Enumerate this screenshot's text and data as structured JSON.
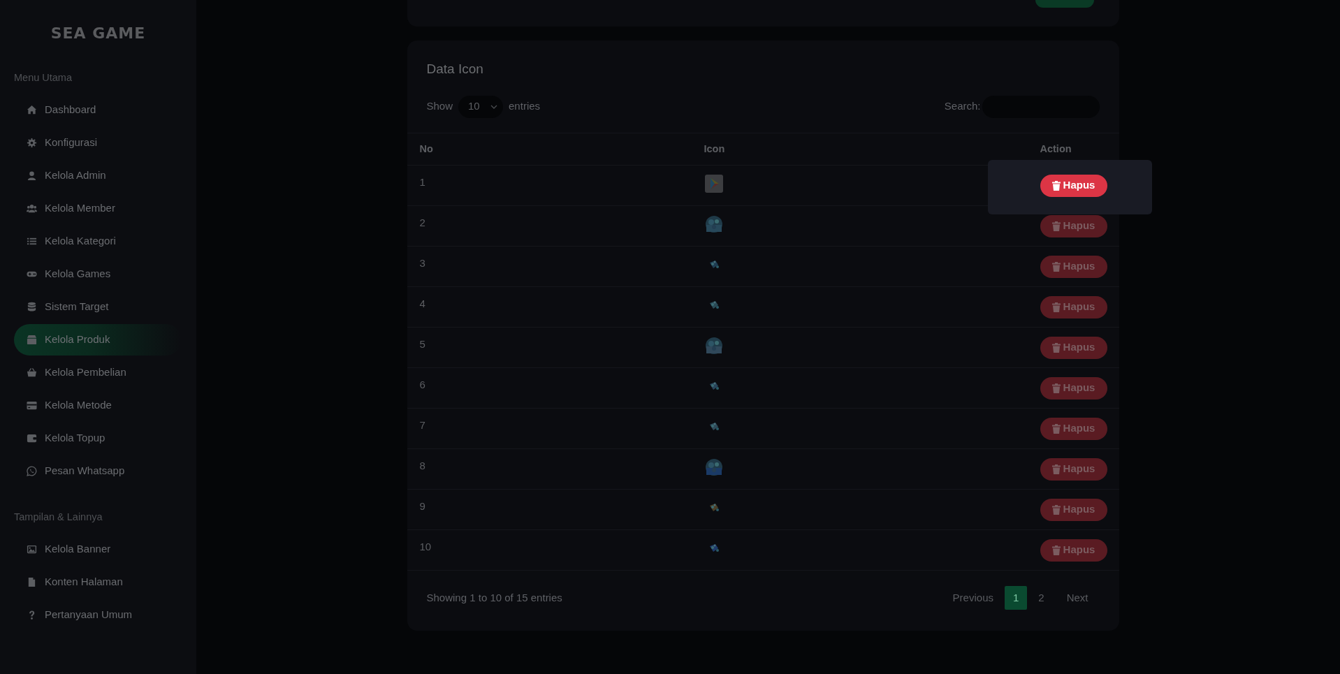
{
  "brand": "SEA GAME",
  "sidebar": {
    "sections": [
      {
        "heading": "Menu Utama",
        "items": [
          {
            "label": "Dashboard",
            "selected": false
          },
          {
            "label": "Konfigurasi",
            "selected": false
          },
          {
            "label": "Kelola Admin",
            "selected": false
          },
          {
            "label": "Kelola Member",
            "selected": false
          },
          {
            "label": "Kelola Kategori",
            "selected": false
          },
          {
            "label": "Kelola Games",
            "selected": false
          },
          {
            "label": "Sistem Target",
            "selected": false
          },
          {
            "label": "Kelola Produk",
            "selected": true
          },
          {
            "label": "Kelola Pembelian",
            "selected": false
          },
          {
            "label": "Kelola Metode",
            "selected": false
          },
          {
            "label": "Kelola Topup",
            "selected": false
          },
          {
            "label": "Pesan Whatsapp",
            "selected": false
          }
        ]
      },
      {
        "heading": "Tampilan & Lainnya",
        "items": [
          {
            "label": "Kelola Banner",
            "selected": false
          },
          {
            "label": "Konten Halaman",
            "selected": false
          },
          {
            "label": "Pertanyaan Umum",
            "selected": false
          }
        ]
      }
    ]
  },
  "card": {
    "title": "Data Icon",
    "length_menu": {
      "before": "Show",
      "value": "10",
      "after": "entries"
    },
    "search": {
      "label": "Search:"
    },
    "columns": [
      "No",
      "Icon",
      "Action"
    ],
    "rows": [
      {
        "no": "1",
        "action": "Hapus",
        "highlighted": true
      },
      {
        "no": "2",
        "action": "Hapus",
        "highlighted": false
      },
      {
        "no": "3",
        "action": "Hapus",
        "highlighted": false
      },
      {
        "no": "4",
        "action": "Hapus",
        "highlighted": false
      },
      {
        "no": "5",
        "action": "Hapus",
        "highlighted": false
      },
      {
        "no": "6",
        "action": "Hapus",
        "highlighted": false
      },
      {
        "no": "7",
        "action": "Hapus",
        "highlighted": false
      },
      {
        "no": "8",
        "action": "Hapus",
        "highlighted": false
      },
      {
        "no": "9",
        "action": "Hapus",
        "highlighted": false
      },
      {
        "no": "10",
        "action": "Hapus",
        "highlighted": false
      }
    ],
    "info": "Showing 1 to 10 of 15 entries",
    "pagination": [
      {
        "label": "Previous",
        "selected": false
      },
      {
        "label": "1",
        "selected": true
      },
      {
        "label": "2",
        "selected": false
      },
      {
        "label": "Next",
        "selected": false
      }
    ]
  }
}
